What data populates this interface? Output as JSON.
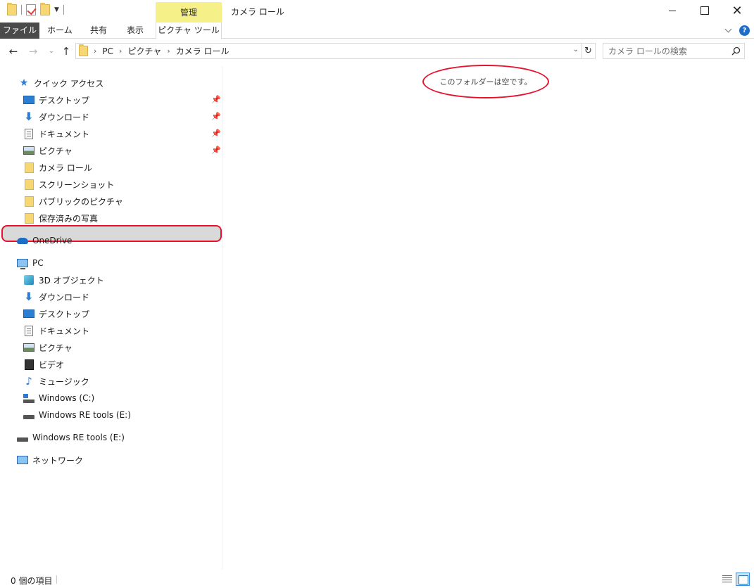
{
  "window": {
    "title": "カメラ ロール",
    "context_tab_group": "管理",
    "buttons": {
      "minimize": "minimize-icon",
      "maximize": "maximize-icon",
      "close": "close-icon"
    }
  },
  "ribbon": {
    "tabs": [
      {
        "label": "ファイル",
        "active": true
      },
      {
        "label": "ホーム"
      },
      {
        "label": "共有"
      },
      {
        "label": "表示"
      },
      {
        "label": "ピクチャ ツール"
      }
    ]
  },
  "address": {
    "breadcrumbs": [
      "PC",
      "ピクチャ",
      "カメラ ロール"
    ]
  },
  "search": {
    "placeholder": "カメラ ロールの検索"
  },
  "navpane": {
    "quick_access": {
      "label": "クイック アクセス",
      "items": [
        {
          "label": "デスクトップ",
          "icon": "desktop-icon",
          "pinned": true
        },
        {
          "label": "ダウンロード",
          "icon": "download-icon",
          "pinned": true
        },
        {
          "label": "ドキュメント",
          "icon": "document-icon",
          "pinned": true
        },
        {
          "label": "ピクチャ",
          "icon": "picture-icon",
          "pinned": true
        },
        {
          "label": "カメラ ロール",
          "icon": "folder-icon",
          "selected": true
        },
        {
          "label": "スクリーンショット",
          "icon": "folder-icon"
        },
        {
          "label": "パブリックのピクチャ",
          "icon": "folder-icon"
        },
        {
          "label": "保存済みの写真",
          "icon": "folder-icon"
        }
      ]
    },
    "onedrive": {
      "label": "OneDrive"
    },
    "pc": {
      "label": "PC",
      "items": [
        {
          "label": "3D オブジェクト",
          "icon": "3d-objects-icon"
        },
        {
          "label": "ダウンロード",
          "icon": "download-icon"
        },
        {
          "label": "デスクトップ",
          "icon": "desktop-icon"
        },
        {
          "label": "ドキュメント",
          "icon": "document-icon"
        },
        {
          "label": "ピクチャ",
          "icon": "picture-icon"
        },
        {
          "label": "ビデオ",
          "icon": "video-icon"
        },
        {
          "label": "ミュージック",
          "icon": "music-icon"
        },
        {
          "label": "Windows (C:)",
          "icon": "windows-drive-icon"
        },
        {
          "label": "Windows RE tools (E:)",
          "icon": "drive-icon"
        }
      ]
    },
    "drive": {
      "label": "Windows RE tools (E:)"
    },
    "network": {
      "label": "ネットワーク"
    }
  },
  "content": {
    "empty_message": "このフォルダーは空です。"
  },
  "statusbar": {
    "item_count": "0 個の項目"
  },
  "colors": {
    "accent": "#1e6cc8",
    "highlight_ring": "#e8112d",
    "manage_tab": "#f5f087",
    "selected_row": "#d9d9d9"
  }
}
